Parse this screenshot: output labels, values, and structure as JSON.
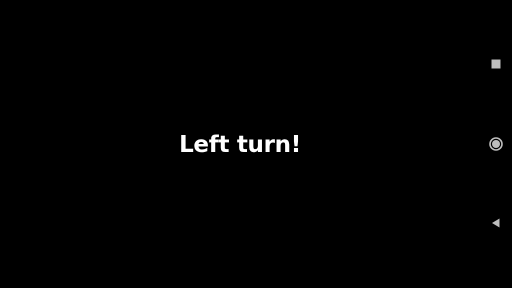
{
  "main": {
    "message": "Left turn!"
  },
  "nav_bar": {
    "buttons": [
      {
        "name": "recents",
        "icon": "square-icon"
      },
      {
        "name": "home",
        "icon": "circle-icon"
      },
      {
        "name": "back",
        "icon": "triangle-back-icon"
      }
    ],
    "icon_color": "#bdbdbd"
  },
  "colors": {
    "background": "#000000",
    "text": "#ffffff"
  }
}
